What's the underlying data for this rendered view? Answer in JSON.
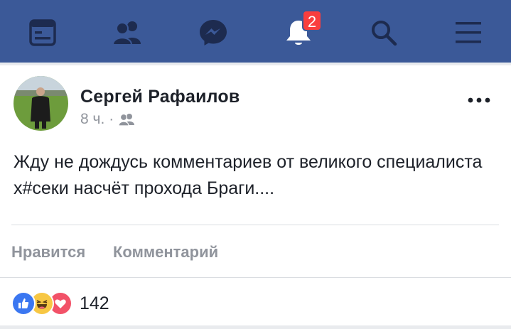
{
  "nav": {
    "icons": [
      "news-feed-icon",
      "friends-icon",
      "messenger-icon",
      "notifications-icon",
      "search-icon",
      "menu-icon"
    ],
    "notification_count": "2",
    "bar_color": "#3b5998",
    "badge_color": "#fa3e3e"
  },
  "post": {
    "author": "Сергей Рафаилов",
    "time": "8 ч.",
    "separator": "·",
    "audience_icon": "friends-audience-icon",
    "text": "Жду не дождусь комментариев от великого специалиста х#секи насчёт прохода Браги...."
  },
  "actions": {
    "like": "Нравится",
    "comment": "Комментарий"
  },
  "reactions": {
    "icons": [
      "like-reaction-icon",
      "haha-reaction-icon",
      "love-reaction-icon"
    ],
    "count": "142"
  }
}
